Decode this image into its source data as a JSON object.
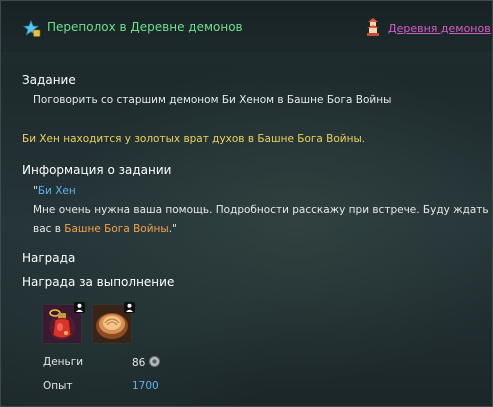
{
  "header": {
    "title": "Переполох в Деревне демонов",
    "zone_link": "Деревня демонов",
    "quest_icon": "quest-star-icon",
    "zone_icon": "pagoda-icon"
  },
  "objective": {
    "heading": "Задание",
    "text": "Поговорить со старшим демоном Би Хеном в Башне Бога Войны",
    "hint": "Би Хен находится у золотых врат духов в Башне Бога Войны."
  },
  "info": {
    "heading": "Информация о задании",
    "speaker_open": "\"",
    "speaker": "Би Хен",
    "line1": "Мне очень нужна ваша помощь. Подробности расскажу при встрече. Буду ждать",
    "line2_prefix": "вас в ",
    "line2_place": "Башне Бога Войны",
    "line2_suffix": ".\""
  },
  "rewards": {
    "heading": "Награда",
    "subheading": "Награда за выполнение",
    "items": [
      {
        "icon": "potion-icon"
      },
      {
        "icon": "dumpling-bowl-icon"
      }
    ],
    "money_label": "Деньги",
    "money_value": "86",
    "money_icon": "silver-coin-icon",
    "exp_label": "Опыт",
    "exp_value": "1700"
  },
  "colors": {
    "title": "#6ce08e",
    "zone_link": "#d65cc8",
    "hint": "#ecd35a",
    "speaker": "#5fb3ec",
    "place": "#f4a24a",
    "exp": "#5fb3ec"
  }
}
